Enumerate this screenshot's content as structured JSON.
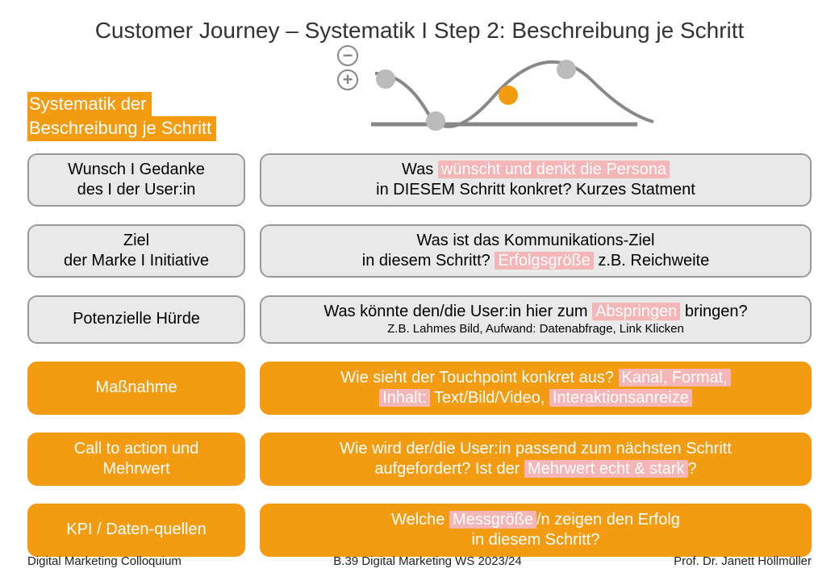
{
  "title": "Customer Journey – Systematik I Step 2: Beschreibung je Schritt",
  "subtitle": {
    "line1": "Systematik der",
    "line2": "Beschreibung je Schritt"
  },
  "plusminus": {
    "minus": "−",
    "plus": "+"
  },
  "rows": [
    {
      "style": "gray",
      "label_l1": "Wunsch I Gedanke",
      "label_l2": "des I der User:in",
      "desc_pre1": "Was ",
      "desc_hl1": "wünscht und denkt die Persona",
      "desc_post1": "",
      "desc_line2": "in DIESEM Schritt konkret? Kurzes Statment"
    },
    {
      "style": "gray",
      "label_l1": "Ziel",
      "label_l2": "der Marke I Initiative",
      "desc_line1": "Was ist das Kommunikations-Ziel",
      "desc_pre2": "in diesem Schritt? ",
      "desc_hl2": "Erfolgsgröße",
      "desc_post2": " z.B. Reichweite"
    },
    {
      "style": "gray",
      "label_l1": "Potenzielle Hürde",
      "label_l2": "",
      "desc_pre1": "Was könnte den/die User:in hier zum ",
      "desc_hl1": "Abspringen",
      "desc_post1": " bringen?",
      "desc_small": "Z.B. Lahmes Bild, Aufwand: Datenabfrage, Link Klicken"
    },
    {
      "style": "orange",
      "label_l1": "Maßnahme",
      "label_l2": "",
      "desc_pre1": "Wie sieht der Touchpoint konkret aus? ",
      "desc_hl1": "Kanal, Format,",
      "desc_post1": "",
      "desc_hl2a": "Inhalt:",
      "desc_mid2": " Text/Bild/Video, ",
      "desc_hl2b": "Interaktionsanreize"
    },
    {
      "style": "orange",
      "label_l1": "Call to action und",
      "label_l2": "Mehrwert",
      "desc_line1": "Wie wird der/die User:in passend zum nächsten Schritt",
      "desc_pre2": "aufgefordert? Ist der ",
      "desc_hl2": "Mehrwert echt & stark",
      "desc_post2": "?"
    },
    {
      "style": "orange",
      "label_l1": "KPI / Daten-quellen",
      "label_l2": "",
      "desc_pre1": "Welche ",
      "desc_hl1": "Messgröße",
      "desc_post1": "/n zeigen den Erfolg",
      "desc_line2": "in diesem Schritt?"
    }
  ],
  "footer": {
    "left": "Digital Marketing Colloquium",
    "center": "B.39 Digital Marketing WS 2023/24",
    "right": "Prof. Dr. Janett Höllmüller"
  }
}
